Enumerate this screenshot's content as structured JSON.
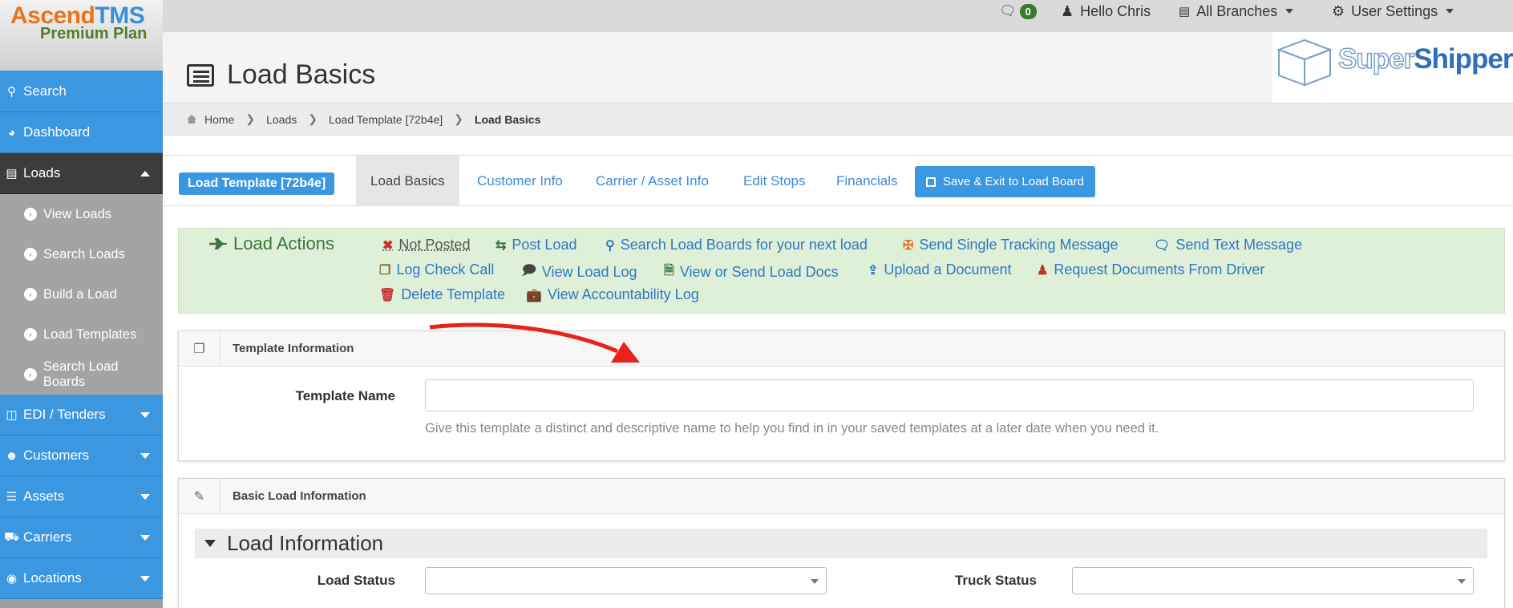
{
  "brand": {
    "name_part1": "Ascend",
    "name_part2": "TMS",
    "plan": "Premium Plan"
  },
  "topbar": {
    "messages_count": "0",
    "greeting": "Hello Chris",
    "branches": "All Branches",
    "settings": "User Settings"
  },
  "sidebar": {
    "items": [
      {
        "label": "Search",
        "icon": "search-icon"
      },
      {
        "label": "Dashboard",
        "icon": "dashboard-icon"
      },
      {
        "label": "Loads",
        "icon": "list-icon"
      }
    ],
    "sub_items": [
      {
        "label": "View Loads"
      },
      {
        "label": "Search Loads"
      },
      {
        "label": "Build a Load"
      },
      {
        "label": "Load Templates"
      },
      {
        "label": "Search Load Boards"
      }
    ],
    "more_items": [
      {
        "label": "EDI / Tenders",
        "icon": "inbox-icon"
      },
      {
        "label": "Customers",
        "icon": "users-icon"
      },
      {
        "label": "Assets",
        "icon": "barcode-icon"
      },
      {
        "label": "Carriers",
        "icon": "truck-icon"
      },
      {
        "label": "Locations",
        "icon": "map-marker-icon"
      }
    ]
  },
  "header": {
    "title": "Load Basics",
    "partner_logo_part1": "Super",
    "partner_logo_part2": "Shippers"
  },
  "breadcrumb": {
    "home": "Home",
    "loads": "Loads",
    "template": "Load Template [72b4e]",
    "current": "Load Basics"
  },
  "tabs": {
    "template_label": "Load Template [72b4e]",
    "items": [
      {
        "label": "Load Basics"
      },
      {
        "label": "Customer Info"
      },
      {
        "label": "Carrier / Asset Info"
      },
      {
        "label": "Edit Stops"
      },
      {
        "label": "Financials"
      }
    ],
    "save_label": "Save & Exit to Load Board"
  },
  "actions": {
    "header": "Load Actions",
    "items": [
      {
        "label": "Not Posted",
        "icon": "x-icon"
      },
      {
        "label": "Post Load",
        "icon": "retweet-icon"
      },
      {
        "label": "Search Load Boards for your next load",
        "icon": "search-icon"
      },
      {
        "label": "Send Single Tracking Message",
        "icon": "crosshairs-icon"
      },
      {
        "label": "Send Text Message",
        "icon": "comment-icon"
      },
      {
        "label": "Log Check Call",
        "icon": "copy-icon"
      },
      {
        "label": "View Load Log",
        "icon": "comments-icon"
      },
      {
        "label": "View or Send Load Docs",
        "icon": "file-icon"
      },
      {
        "label": "Upload a Document",
        "icon": "upload-icon"
      },
      {
        "label": "Request Documents From Driver",
        "icon": "user-icon"
      },
      {
        "label": "Delete Template",
        "icon": "trash-icon"
      },
      {
        "label": "View Accountability Log",
        "icon": "briefcase-icon"
      }
    ]
  },
  "template_panel": {
    "title": "Template Information",
    "field_label": "Template Name",
    "field_value": "",
    "help": "Give this template a distinct and descriptive name to help you find in in your saved templates at a later date when you need it."
  },
  "basic_panel": {
    "title": "Basic Load Information",
    "section": "Load Information",
    "load_status_label": "Load Status",
    "truck_status_label": "Truck Status"
  }
}
